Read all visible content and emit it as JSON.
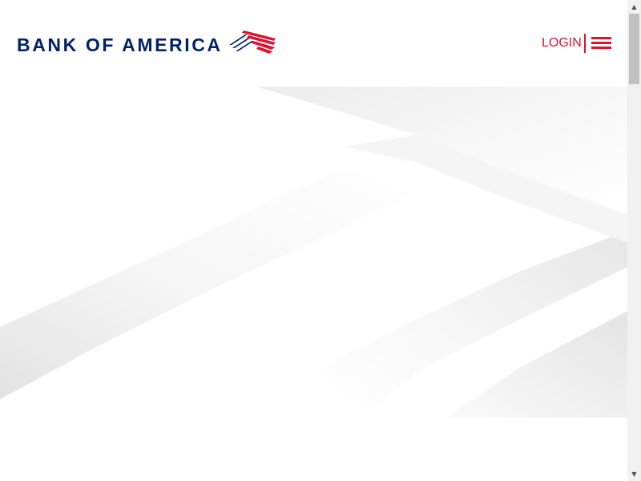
{
  "header": {
    "logo_text": "BANK OF AMERICA",
    "login_label": "LOGIN",
    "menu_icon": "hamburger-menu-icon"
  },
  "colors": {
    "brand_navy": "#012169",
    "brand_red": "#dc1431",
    "background": "#ffffff"
  },
  "scrollbar": {
    "up_arrow": "▲",
    "down_arrow": "▼"
  }
}
